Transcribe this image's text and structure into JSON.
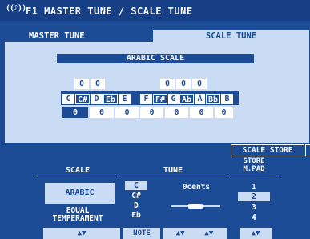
{
  "title": "F1 MASTER TUNE / SCALE TUNE",
  "tabs": [
    "MASTER TUNE",
    "SCALE TUNE"
  ],
  "scale_name": "ARABIC SCALE",
  "upper_values": [
    "0",
    "0",
    "0",
    "0",
    "0"
  ],
  "notes": [
    "C",
    "C#",
    "D",
    "Eb",
    "E",
    "F",
    "F#",
    "G",
    "Ab",
    "A",
    "Bb",
    "B"
  ],
  "lower_values": [
    "0",
    "0",
    "0",
    "0",
    "0",
    "0",
    "0"
  ],
  "scale_store": "SCALE STORE",
  "scale_header": "SCALE",
  "tune_header": "TUNE",
  "store_header": "STORE\nM.PAD",
  "scale_value": "ARABIC",
  "scale_alt": "EQUAL\nTEMPERAMENT",
  "tune_notes": [
    "C",
    "C#",
    "D",
    "Eb"
  ],
  "tune_cents": "0cents",
  "store_pads": [
    "1",
    "2",
    "3",
    "4"
  ],
  "btn_note": "NOTE"
}
